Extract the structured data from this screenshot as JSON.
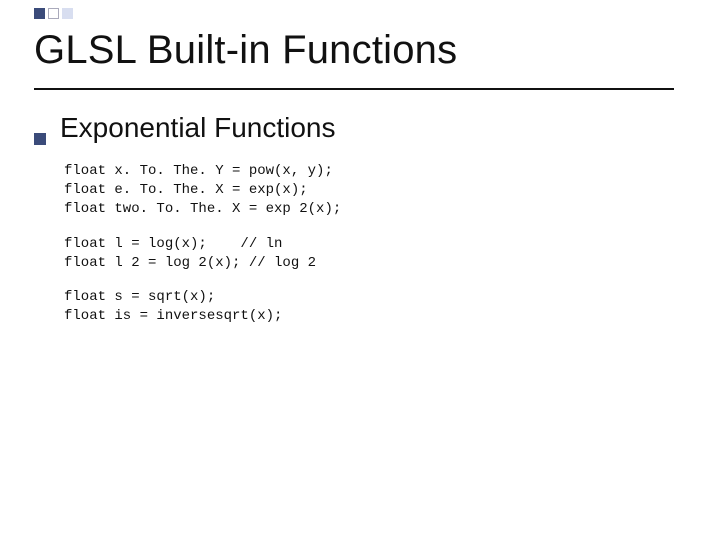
{
  "title": "GLSL Built-in Functions",
  "subheading": "Exponential Functions",
  "code": {
    "block1": "float x. To. The. Y = pow(x, y);\nfloat e. To. The. X = exp(x);\nfloat two. To. The. X = exp 2(x);",
    "block2": "float l = log(x);    // ln\nfloat l 2 = log 2(x); // log 2",
    "block3": "float s = sqrt(x);\nfloat is = inversesqrt(x);"
  }
}
